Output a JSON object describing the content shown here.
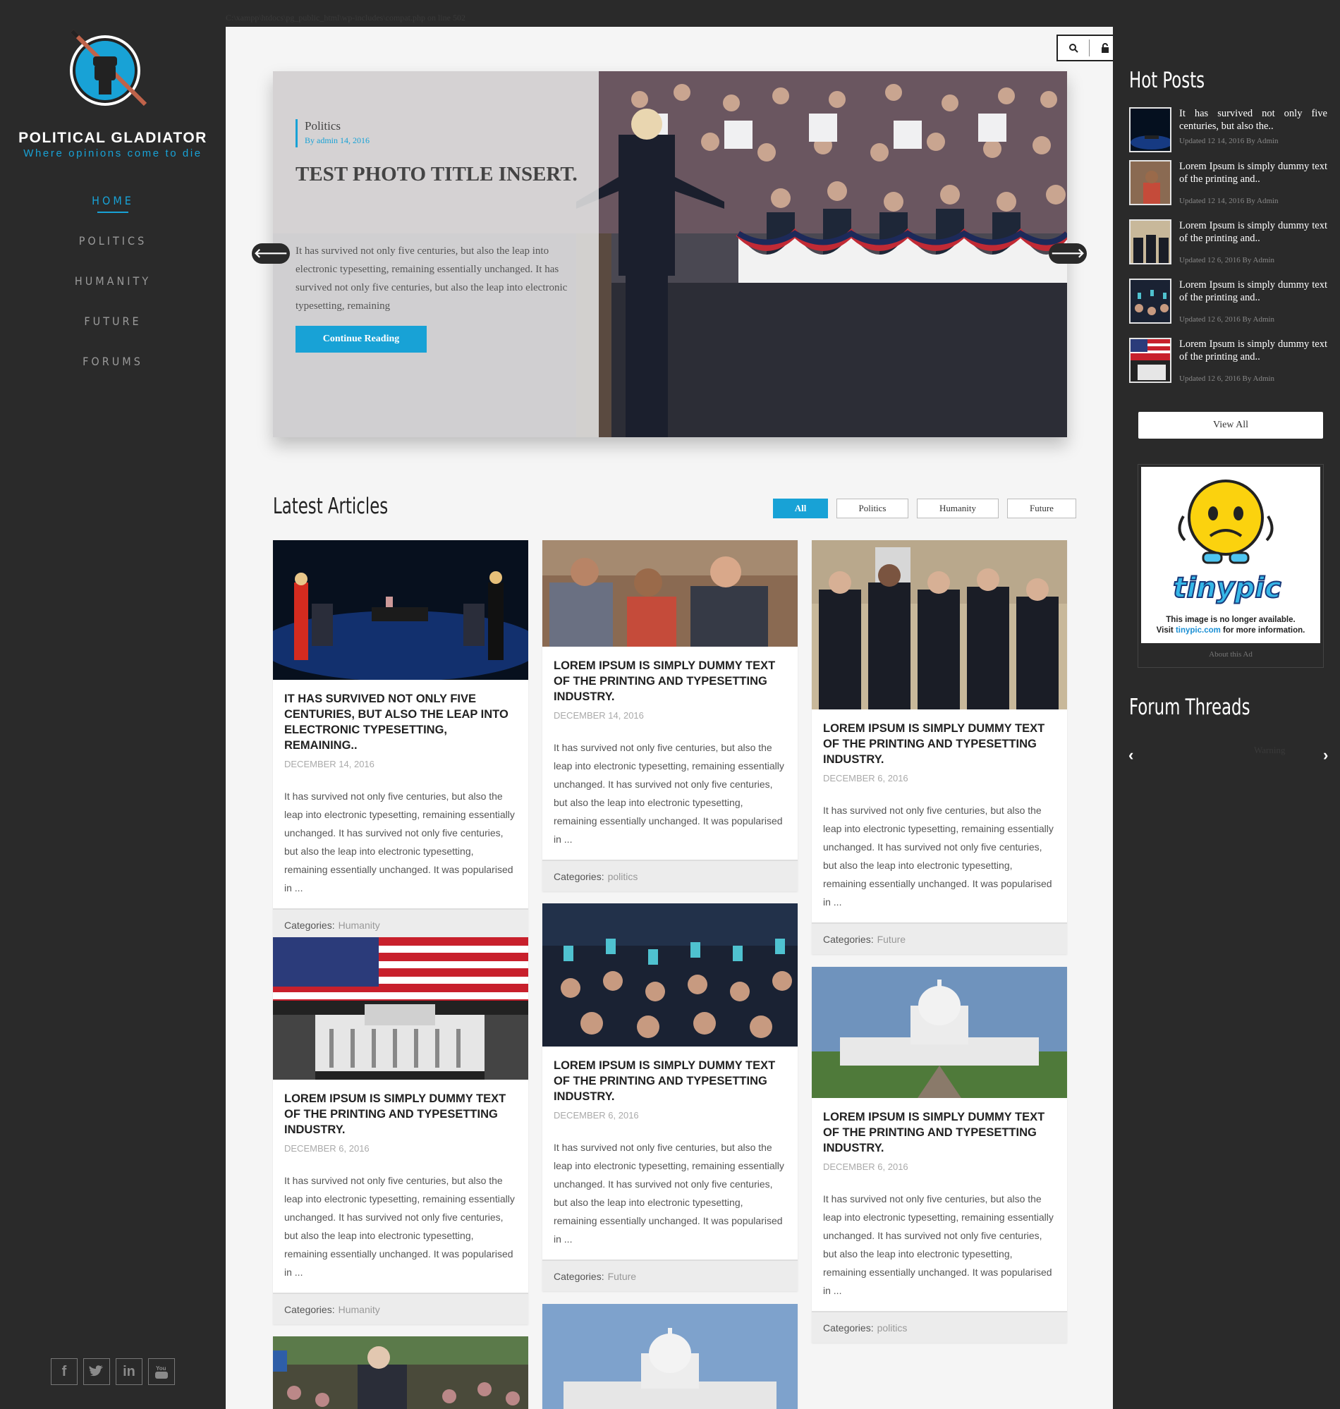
{
  "path_text": "C:\\xampp\\htdocs\\pg_public_html\\wp-includes\\compat.php on line 502",
  "brand": {
    "name": "POLITICAL GLADIATOR",
    "tagline": "Where opinions come to die"
  },
  "nav": [
    {
      "label": "HOME",
      "active": true
    },
    {
      "label": "POLITICS",
      "active": false
    },
    {
      "label": "HUMANITY",
      "active": false
    },
    {
      "label": "FUTURE",
      "active": false
    },
    {
      "label": "FORUMS",
      "active": false
    }
  ],
  "social": [
    "f",
    "t",
    "in",
    "yt"
  ],
  "topbar_icons": [
    "search-icon",
    "lock-icon",
    "user-icon"
  ],
  "slider": {
    "category": "Politics",
    "meta": "By admin 14, 2016",
    "title": "TEST PHOTO TITLE INSERT.",
    "excerpt": "It has survived not only five centuries, but also the leap into electronic typesetting, remaining essentially unchanged.     It has survived not only five centuries, but also the leap into electronic typesetting, remaining",
    "button": "Continue Reading"
  },
  "latest": {
    "title": "Latest Articles",
    "filters": [
      "All",
      "Politics",
      "Humanity",
      "Future"
    ],
    "active_filter": "All",
    "categories_label": "Categories:",
    "cards": [
      {
        "title": "IT HAS SURVIVED NOT ONLY FIVE CENTURIES, BUT ALSO THE LEAP INTO ELECTRONIC TYPESETTING, REMAINING..",
        "date": "DECEMBER 14, 2016",
        "excerpt": "It has survived not only five centuries, but also the leap into electronic typesetting, remaining essentially unchanged.     It has survived not only five centuries, but also the leap into electronic typesetting, remaining essentially unchanged. It was popularised in ...",
        "category": "Humanity"
      },
      {
        "title": "LOREM IPSUM IS SIMPLY DUMMY TEXT OF THE PRINTING AND TYPESETTING INDUSTRY.",
        "date": "DECEMBER 14, 2016",
        "excerpt": "It has survived not only five centuries, but also the leap into electronic typesetting, remaining essentially unchanged.     It has survived not only five centuries, but also the leap into electronic typesetting, remaining essentially unchanged. It was popularised in ...",
        "category": "politics"
      },
      {
        "title": "LOREM IPSUM IS SIMPLY DUMMY TEXT OF THE PRINTING AND TYPESETTING INDUSTRY.",
        "date": "DECEMBER 6, 2016",
        "excerpt": "It has survived not only five centuries, but also the leap into electronic typesetting, remaining essentially unchanged.     It has survived not only five centuries, but also the leap into electronic typesetting, remaining essentially unchanged. It was popularised in ...",
        "category": "Future"
      },
      {
        "title": "LOREM IPSUM IS SIMPLY DUMMY TEXT OF THE PRINTING AND TYPESETTING INDUSTRY.",
        "date": "DECEMBER 6, 2016",
        "excerpt": "It has survived not only five centuries, but also the leap into electronic typesetting, remaining essentially unchanged.     It has survived not only five centuries, but also the leap into electronic typesetting, remaining essentially unchanged. It was popularised in ...",
        "category": "Humanity"
      },
      {
        "title": "LOREM IPSUM IS SIMPLY DUMMY TEXT OF THE PRINTING AND TYPESETTING INDUSTRY.",
        "date": "DECEMBER 6, 2016",
        "excerpt": "It has survived not only five centuries, but also the leap into electronic typesetting, remaining essentially unchanged.     It has survived not only five centuries, but also the leap into electronic typesetting, remaining essentially unchanged. It was popularised in ...",
        "category": "Future"
      },
      {
        "title": "LOREM IPSUM IS SIMPLY DUMMY TEXT OF THE PRINTING AND TYPESETTING INDUSTRY.",
        "date": "DECEMBER 6, 2016",
        "excerpt": "It has survived not only five centuries, but also the leap into electronic typesetting, remaining essentially unchanged.     It has survived not only five centuries, but also the leap into electronic typesetting, remaining essentially unchanged. It was popularised in ...",
        "category": "politics"
      }
    ]
  },
  "hot_posts": {
    "title": "Hot Posts",
    "items": [
      {
        "text": "It has survived not only five centuries, but also the..",
        "meta": "Updated 12 14, 2016 By Admin"
      },
      {
        "text": "Lorem Ipsum is simply dummy text of the printing and..",
        "meta": "Updated 12 14, 2016 By Admin"
      },
      {
        "text": "Lorem Ipsum is simply dummy text of the printing and..",
        "meta": "Updated 12 6, 2016 By Admin"
      },
      {
        "text": "Lorem Ipsum is simply dummy text of the printing and..",
        "meta": "Updated 12 6, 2016 By Admin"
      },
      {
        "text": "Lorem Ipsum is simply dummy text of the printing and..",
        "meta": "Updated 12 6, 2016 By Admin"
      }
    ],
    "view_all": "View All"
  },
  "ad": {
    "brand": "tinypic",
    "line1": "This image is no longer available.",
    "line2_pre": "Visit ",
    "line2_link": "tinypic.com",
    "line2_post": " for more information.",
    "about": "About this Ad"
  },
  "forum": {
    "title": "Forum Threads",
    "warning": "Warning"
  },
  "colors": {
    "accent": "#18a2d6",
    "sidebar": "#2a2a2a",
    "main_bg": "#f5f5f5"
  }
}
